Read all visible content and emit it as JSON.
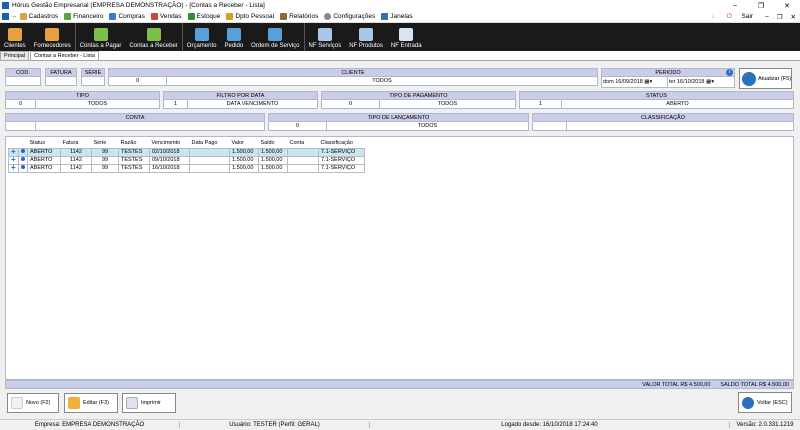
{
  "window": {
    "title": "Hórus Gestão Empresarial (EMPRESA DEMONSTRAÇÃO) - [Contas a Receber - Lista]",
    "min": "–",
    "max": "❐",
    "close": "✕"
  },
  "menu": {
    "items": [
      "Cadastros",
      "Financeiro",
      "Compras",
      "Vendas",
      "Estoque",
      "Dpto Pessoal",
      "Relatórios",
      "Configurações",
      "Janelas"
    ],
    "sair": "Sair",
    "right_icons": [
      "–",
      "❐",
      "✕"
    ]
  },
  "toolbar": [
    "Clientes",
    "Fornecedores",
    "Contas a Pagar",
    "Contas a Receber",
    "Orçamento",
    "Pedido",
    "Ordem de Serviço",
    "NF Serviços",
    "NF Produtos",
    "NF Entrada"
  ],
  "tabs": [
    "Principal",
    "Contas a Receber - Lista"
  ],
  "filters": {
    "cod": {
      "label": "COD.",
      "value": ""
    },
    "fatura": {
      "label": "FATURA",
      "value": ""
    },
    "serie": {
      "label": "SÉRIE",
      "value": ""
    },
    "cliente": {
      "label": "CLIENTE",
      "code": "0",
      "value": "TODOS"
    },
    "periodo": {
      "label": "PERIODO",
      "from": "dom 16/09/2018",
      "to": "ter 16/10/2018"
    },
    "atualizar": "Atualizar (F5)",
    "tipo": {
      "label": "TIPO",
      "code": "0",
      "value": "TODOS"
    },
    "filtro_data": {
      "label": "FILTRO POR DATA",
      "code": "1",
      "value": "DATA VENCIMENTO"
    },
    "tipo_pagamento": {
      "label": "TIPO DE PAGAMENTO",
      "code": "0",
      "value": "TODOS"
    },
    "status": {
      "label": "STATUS",
      "code": "1",
      "value": "ABERTO"
    },
    "conta": {
      "label": "CONTA",
      "code": "",
      "value": ""
    },
    "tipo_lancamento": {
      "label": "TIPO DE LANÇAMENTO",
      "code": "0",
      "value": "TODOS"
    },
    "classificacao": {
      "label": "CLASSIFICAÇÃO",
      "code": "",
      "value": ""
    }
  },
  "table": {
    "headers": [
      "Status",
      "Fatura",
      "Série",
      "Razão",
      "Vencimento",
      "Data Pago",
      "Valor",
      "Saldo",
      "Conta",
      "Classificação"
    ],
    "rows": [
      [
        "ABERTO",
        "1142",
        "99",
        "TESTES",
        "02/10/2018",
        "",
        "1.500,00",
        "1.500,00",
        "",
        "7.1-SERVIÇO"
      ],
      [
        "ABERTO",
        "1142",
        "99",
        "TESTES",
        "09/10/2018",
        "",
        "1.500,00",
        "1.500,00",
        "",
        "7.1-SERVIÇO"
      ],
      [
        "ABERTO",
        "1142",
        "99",
        "TESTES",
        "16/10/2018",
        "",
        "1.500,00",
        "1.500,00",
        "",
        "7.1-SERVIÇO"
      ]
    ]
  },
  "totals": {
    "valor": "VALOR TOTAL R$ 4.500,00",
    "saldo": "SALDO TOTAL R$ 4.500,00"
  },
  "buttons": {
    "novo": "Novo (F2)",
    "editar": "Editar (F3)",
    "imprimir": "Imprimir",
    "voltar": "Voltar (ESC)"
  },
  "status": {
    "empresa": "Empresa: EMPRESA DEMONSTRAÇÃO",
    "usuario": "Usuário: TESTER (Perfil: GERAL)",
    "logado": "Logado desde: 16/10/2018 17:24:40",
    "versao": "Versão: 2.0.331.1219"
  },
  "colors": {
    "header_bg": "#c9cde8",
    "toolbar_bg": "#1a1a1a",
    "selected_row": "#c8e6f0"
  }
}
